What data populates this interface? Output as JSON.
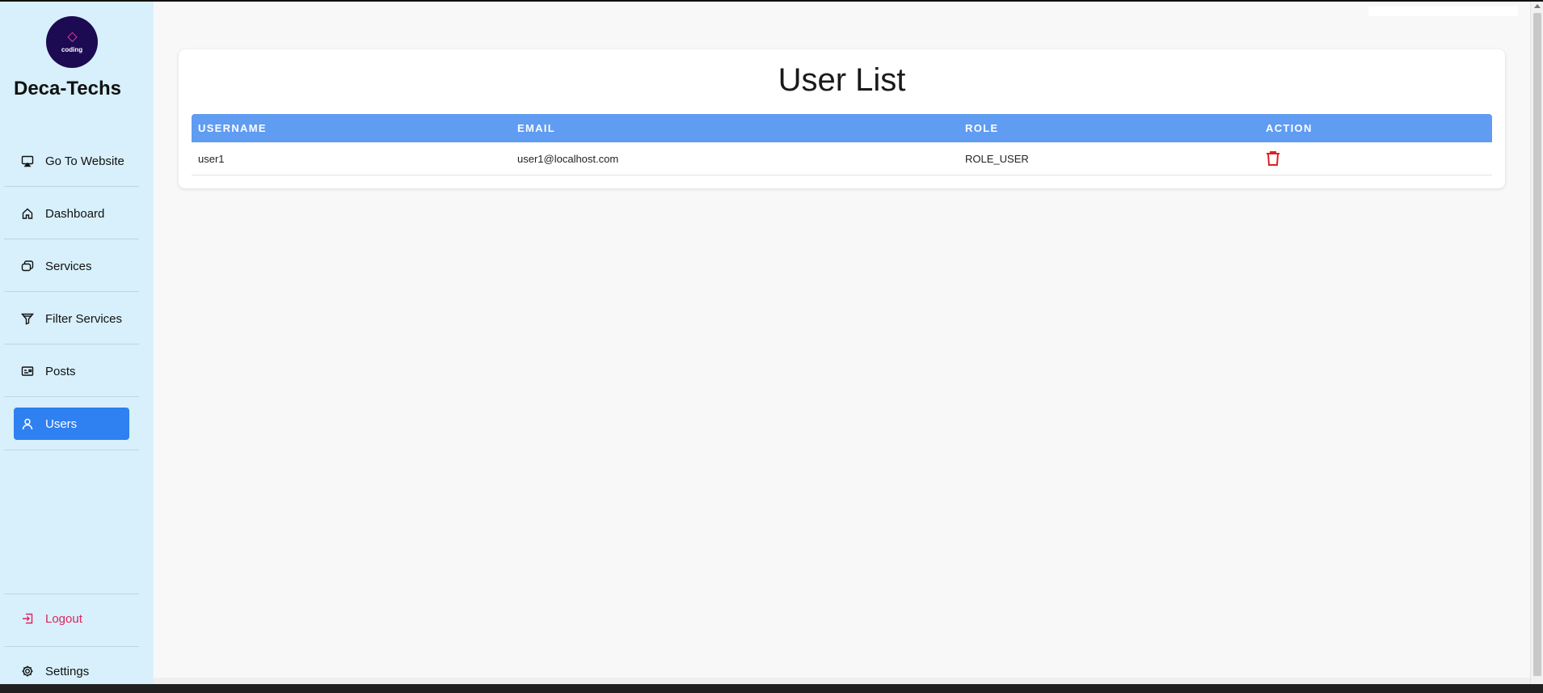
{
  "sidebar": {
    "logo_text": "coding",
    "logo_glyph": "◇",
    "brand": "Deca-Techs",
    "items": [
      {
        "label": "Go To Website",
        "icon": "monitor-cast-icon"
      },
      {
        "label": "Dashboard",
        "icon": "home-icon"
      },
      {
        "label": "Services",
        "icon": "layers-icon"
      },
      {
        "label": "Filter Services",
        "icon": "filter-icon"
      },
      {
        "label": "Posts",
        "icon": "card-icon"
      },
      {
        "label": "Users",
        "icon": "user-icon",
        "active": true
      }
    ],
    "logout_label": "Logout",
    "settings_label": "Settings"
  },
  "main": {
    "title": "User List",
    "table": {
      "headers": [
        "USERNAME",
        "EMAIL",
        "ROLE",
        "ACTION"
      ],
      "rows": [
        {
          "username": "user1",
          "email": "user1@localhost.com",
          "role": "ROLE_USER",
          "action_icon": "trash-icon"
        }
      ]
    }
  },
  "colors": {
    "sidebar_bg": "#d7f0fb",
    "active_item": "#2f80f0",
    "table_header": "#5f9cf2",
    "logout": "#e0245e",
    "delete": "#e02020"
  }
}
